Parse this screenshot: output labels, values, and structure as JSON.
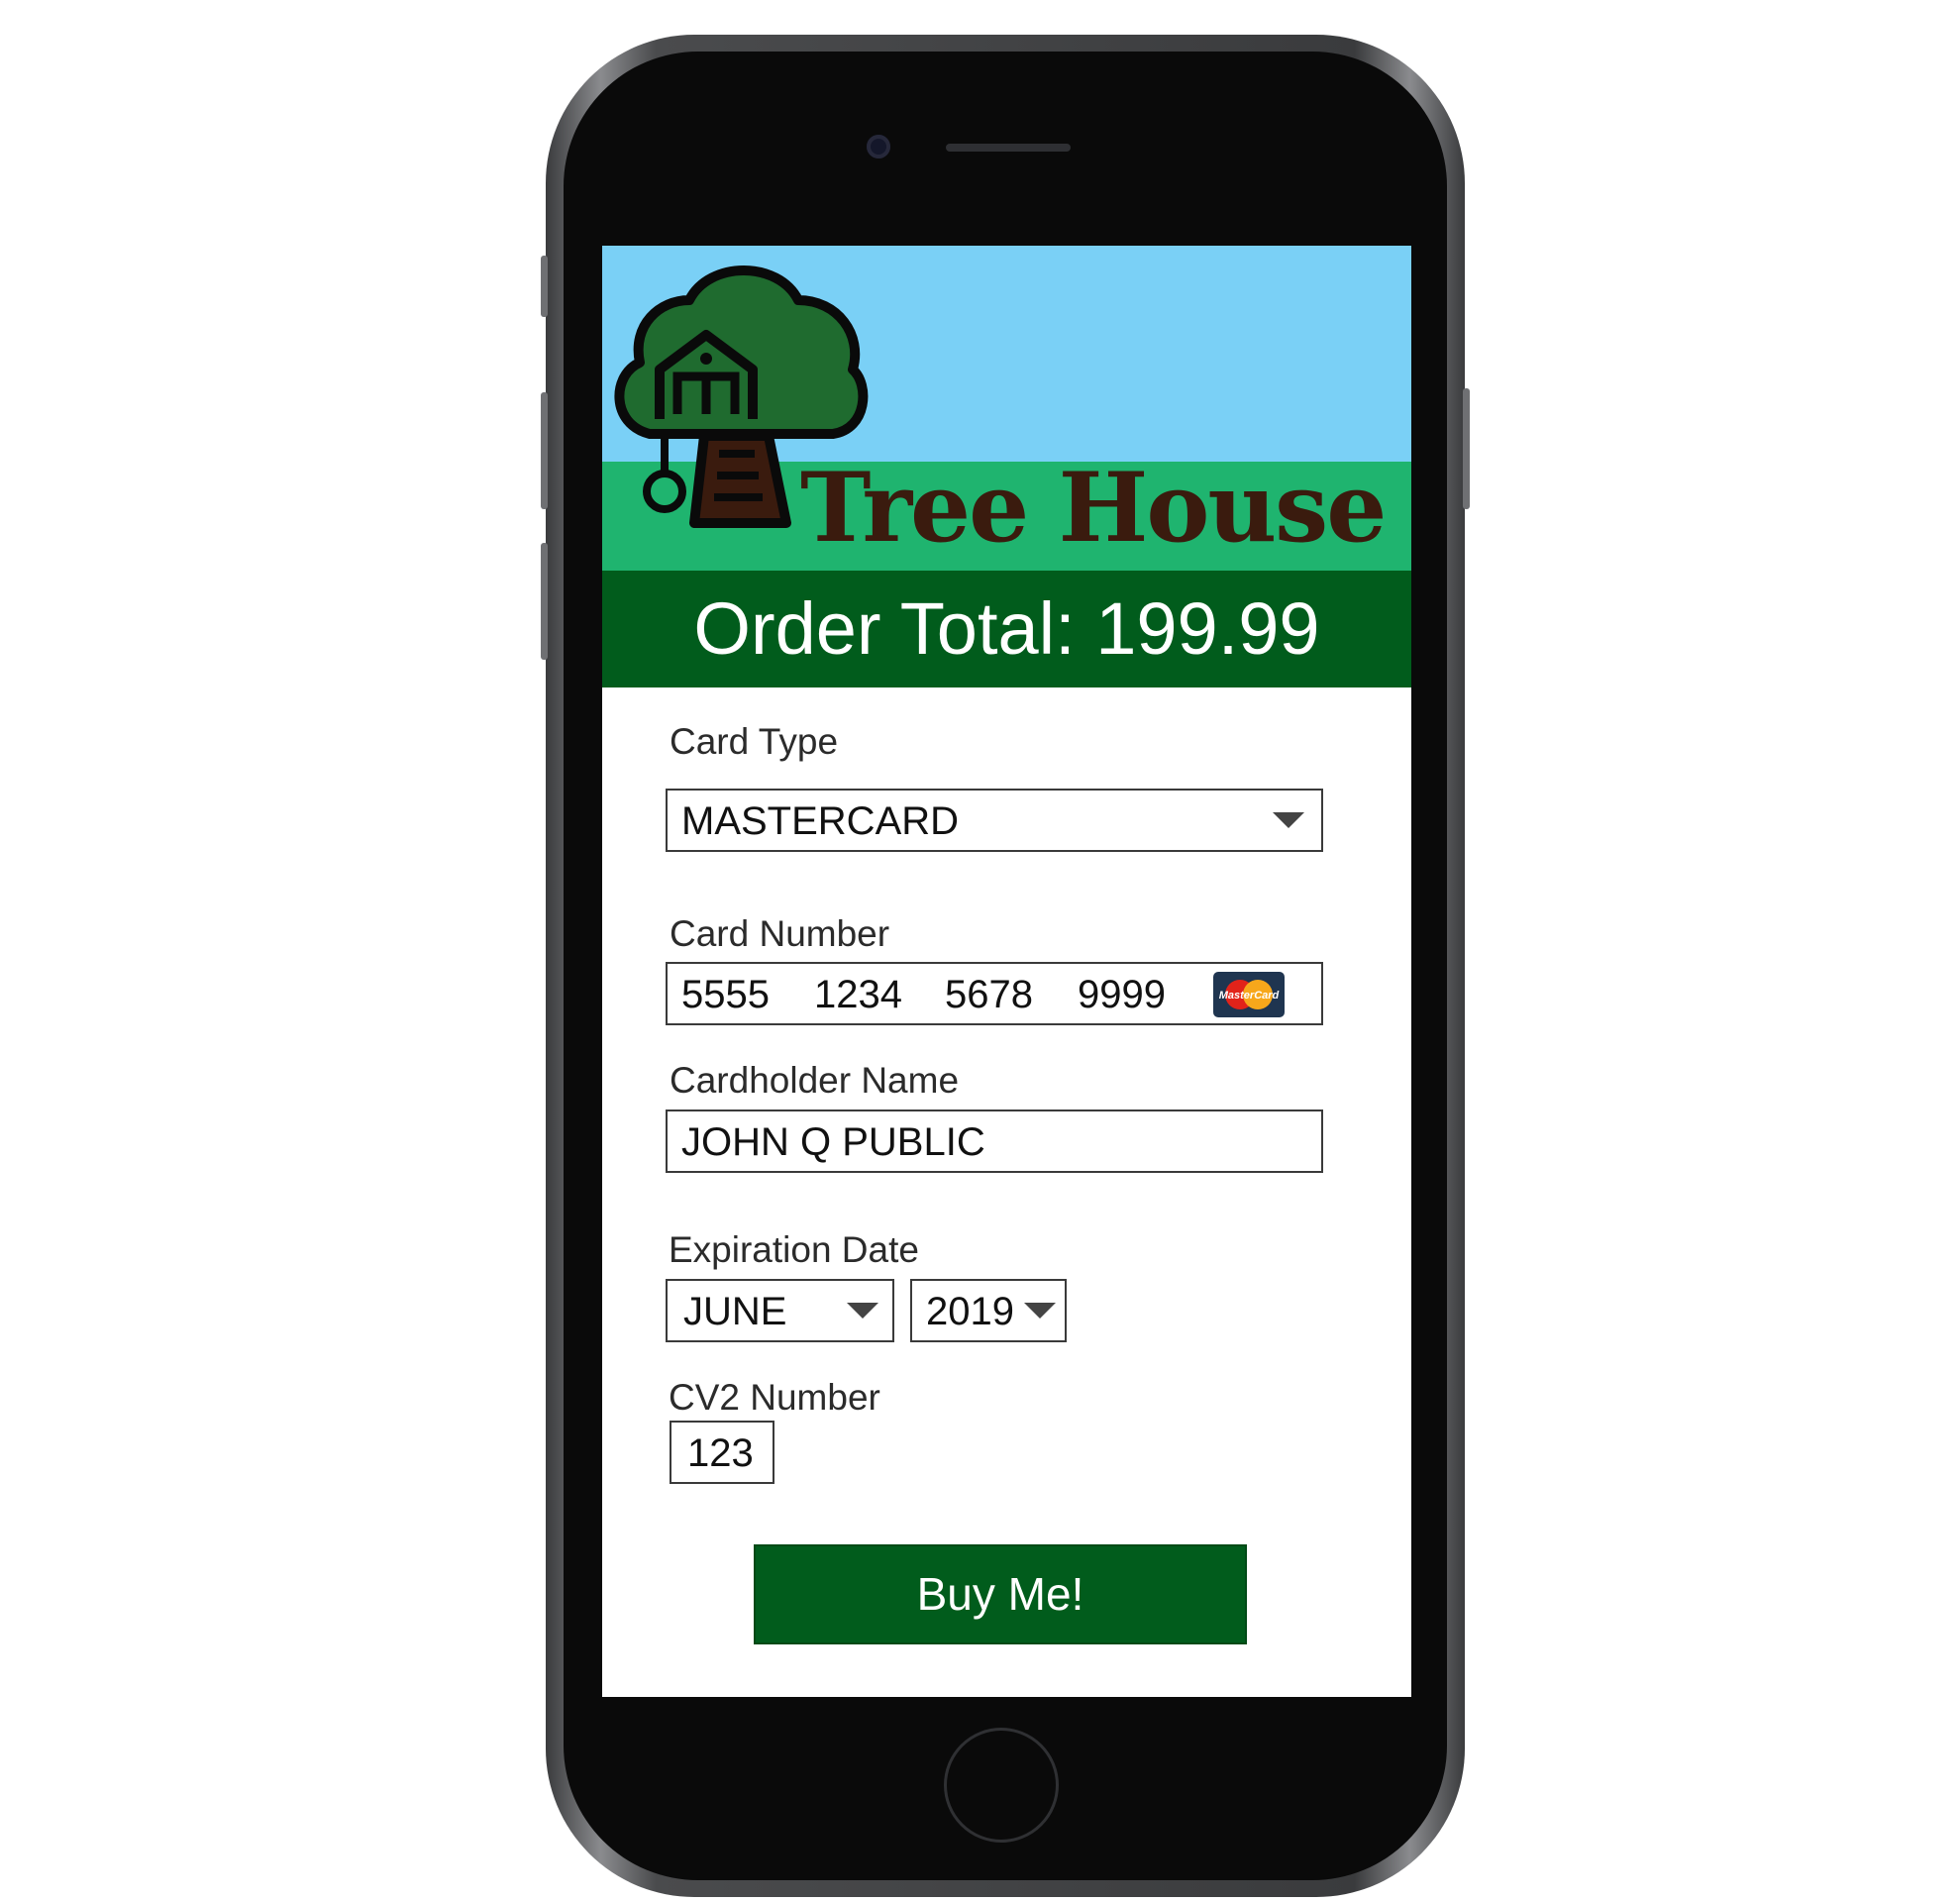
{
  "brand": {
    "title": "Tree House"
  },
  "order": {
    "total_text": "Order Total: 199.99"
  },
  "form": {
    "card_type": {
      "label": "Card Type",
      "value": "MASTERCARD"
    },
    "card_number": {
      "label": "Card Number",
      "groups": [
        "5555",
        "1234",
        "5678",
        "9999"
      ],
      "brand_logo_text": "MasterCard"
    },
    "cardholder": {
      "label": "Cardholder Name",
      "value": "JOHN Q PUBLIC"
    },
    "expiration": {
      "label": "Expiration Date",
      "month": "JUNE",
      "year": "2019"
    },
    "cv2": {
      "label": "CV2 Number",
      "value": "123"
    }
  },
  "buy_button": {
    "label": "Buy Me!"
  },
  "colors": {
    "sky": "#7ad0f6",
    "grass": "#1fb46f",
    "dark_green": "#015c1c",
    "tree": "#1f6b2f",
    "trunk": "#3a1b0e"
  },
  "icons": {
    "logo": "tree-house-icon",
    "dropdown": "caret-down-icon",
    "card": "mastercard-icon"
  }
}
